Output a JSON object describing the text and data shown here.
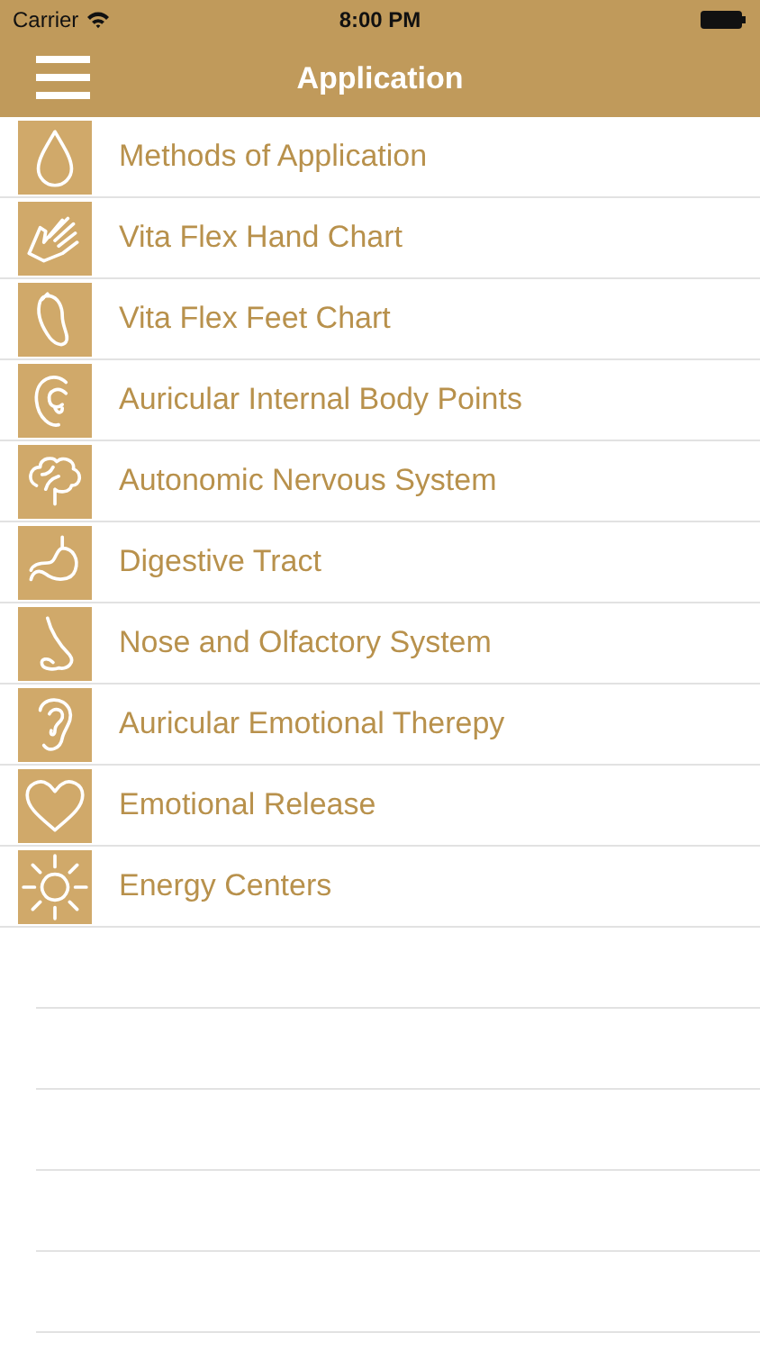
{
  "status_bar": {
    "carrier": "Carrier",
    "time": "8:00 PM"
  },
  "nav_bar": {
    "title": "Application"
  },
  "items": [
    {
      "label": "Methods of Application"
    },
    {
      "label": "Vita Flex Hand Chart"
    },
    {
      "label": "Vita Flex Feet Chart"
    },
    {
      "label": "Auricular Internal Body Points"
    },
    {
      "label": "Autonomic Nervous System"
    },
    {
      "label": "Digestive Tract"
    },
    {
      "label": "Nose and Olfactory System"
    },
    {
      "label": "Auricular Emotional Therepy"
    },
    {
      "label": "Emotional Release"
    },
    {
      "label": "Energy Centers"
    }
  ]
}
